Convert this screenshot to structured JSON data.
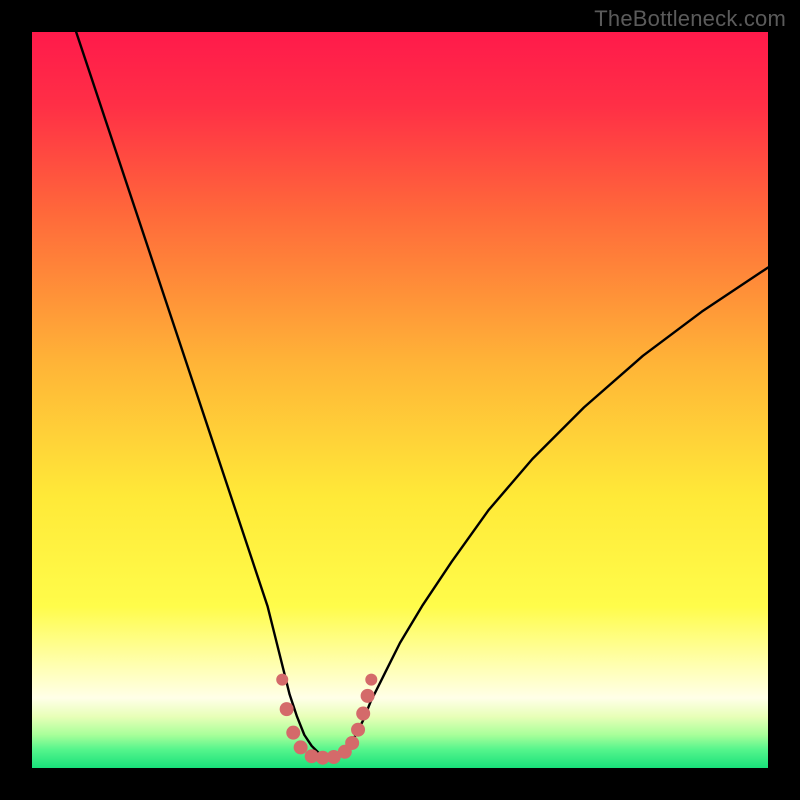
{
  "watermark": {
    "text": "TheBottleneck.com"
  },
  "colors": {
    "gradient_stops": [
      {
        "offset": 0.0,
        "color": "#ff1a4b"
      },
      {
        "offset": 0.1,
        "color": "#ff2f46"
      },
      {
        "offset": 0.25,
        "color": "#ff6a3a"
      },
      {
        "offset": 0.45,
        "color": "#ffb437"
      },
      {
        "offset": 0.63,
        "color": "#ffe938"
      },
      {
        "offset": 0.78,
        "color": "#fffc4a"
      },
      {
        "offset": 0.86,
        "color": "#ffffb0"
      },
      {
        "offset": 0.905,
        "color": "#ffffe8"
      },
      {
        "offset": 0.93,
        "color": "#e8ffb8"
      },
      {
        "offset": 0.955,
        "color": "#a8ff9a"
      },
      {
        "offset": 0.975,
        "color": "#55f58c"
      },
      {
        "offset": 1.0,
        "color": "#18e07a"
      }
    ],
    "curve": "#000000",
    "marker_fill": "#d46a6a",
    "marker_stroke": "#c05858"
  },
  "chart_data": {
    "type": "line",
    "title": "",
    "xlabel": "",
    "ylabel": "",
    "xlim": [
      0,
      100
    ],
    "ylim": [
      0,
      100
    ],
    "series": [
      {
        "name": "bottleneck-curve",
        "x": [
          6,
          8,
          10,
          12,
          14,
          16,
          18,
          20,
          22,
          24,
          26,
          28,
          30,
          32,
          33,
          34,
          35,
          36,
          37,
          38,
          39,
          40,
          41,
          42,
          43,
          44,
          45,
          46,
          48,
          50,
          53,
          57,
          62,
          68,
          75,
          83,
          91,
          100
        ],
        "y": [
          100,
          94,
          88,
          82,
          76,
          70,
          64,
          58,
          52,
          46,
          40,
          34,
          28,
          22,
          18,
          14,
          10,
          7,
          4.5,
          3,
          2,
          1.5,
          1.5,
          2,
          3,
          4.5,
          6.5,
          9,
          13,
          17,
          22,
          28,
          35,
          42,
          49,
          56,
          62,
          68
        ]
      }
    ],
    "markers": {
      "name": "highlight-points",
      "x": [
        34.0,
        34.6,
        35.5,
        36.5,
        38.0,
        39.5,
        41.0,
        42.5,
        43.5,
        44.3,
        45.0,
        45.6,
        46.1
      ],
      "y": [
        12.0,
        8.0,
        4.8,
        2.8,
        1.6,
        1.4,
        1.5,
        2.2,
        3.4,
        5.2,
        7.4,
        9.8,
        12.0
      ],
      "radius": [
        6,
        7,
        7,
        7,
        7,
        7,
        7,
        7,
        7,
        7,
        7,
        7,
        6
      ]
    }
  }
}
